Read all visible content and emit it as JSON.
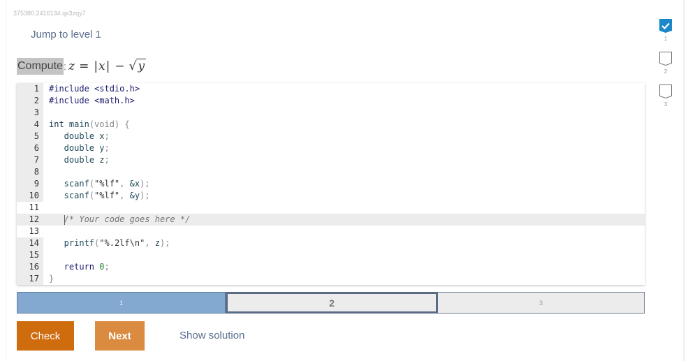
{
  "activity_id": "375380.2416134.qx3zqy7",
  "jump_link": "Jump to level 1",
  "prompt": {
    "label": "Compute",
    "colon": ":",
    "math": {
      "lhs": "z",
      "eq": "=",
      "abs_open": "|",
      "x": "x",
      "abs_close": "|",
      "minus": "−",
      "sqrt": "√",
      "y": "y"
    }
  },
  "editor": {
    "lines": [
      {
        "n": "1",
        "tokens": [
          {
            "t": "#include <stdio.h>",
            "c": "pre"
          }
        ]
      },
      {
        "n": "2",
        "tokens": [
          {
            "t": "#include <math.h>",
            "c": "pre"
          }
        ]
      },
      {
        "n": "3",
        "tokens": []
      },
      {
        "n": "4",
        "tokens": [
          {
            "t": "int",
            "c": "kw"
          },
          {
            "t": " main",
            "c": "fn"
          },
          {
            "t": "(void) {",
            "c": "punc"
          }
        ]
      },
      {
        "n": "5",
        "tokens": [
          {
            "t": "   double",
            "c": "type"
          },
          {
            "t": " x",
            "c": "fn"
          },
          {
            "t": ";",
            "c": "punc"
          }
        ]
      },
      {
        "n": "6",
        "tokens": [
          {
            "t": "   double",
            "c": "type"
          },
          {
            "t": " y",
            "c": "fn"
          },
          {
            "t": ";",
            "c": "punc"
          }
        ]
      },
      {
        "n": "7",
        "tokens": [
          {
            "t": "   double",
            "c": "type"
          },
          {
            "t": " z",
            "c": "fn"
          },
          {
            "t": ";",
            "c": "punc"
          }
        ]
      },
      {
        "n": "8",
        "tokens": []
      },
      {
        "n": "9",
        "tokens": [
          {
            "t": "   scanf",
            "c": "fn"
          },
          {
            "t": "(",
            "c": "punc"
          },
          {
            "t": "\"%lf\"",
            "c": "str"
          },
          {
            "t": ", ",
            "c": "punc"
          },
          {
            "t": "&x",
            "c": "fn"
          },
          {
            "t": ");",
            "c": "punc"
          }
        ]
      },
      {
        "n": "10",
        "tokens": [
          {
            "t": "   scanf",
            "c": "fn"
          },
          {
            "t": "(",
            "c": "punc"
          },
          {
            "t": "\"%lf\"",
            "c": "str"
          },
          {
            "t": ", ",
            "c": "punc"
          },
          {
            "t": "&y",
            "c": "fn"
          },
          {
            "t": ");",
            "c": "punc"
          }
        ]
      },
      {
        "n": "11",
        "tokens": [],
        "editable": true
      },
      {
        "n": "12",
        "tokens": [
          {
            "t": "   ",
            "c": "fn"
          },
          {
            "t": "|cursor|",
            "c": "cursor"
          },
          {
            "t": "/* Your code goes here */",
            "c": "comment"
          }
        ],
        "editable": true,
        "active": true
      },
      {
        "n": "13",
        "tokens": [],
        "editable": true
      },
      {
        "n": "14",
        "tokens": [
          {
            "t": "   printf",
            "c": "fn"
          },
          {
            "t": "(",
            "c": "punc"
          },
          {
            "t": "\"%.2lf\\n\"",
            "c": "str"
          },
          {
            "t": ", ",
            "c": "punc"
          },
          {
            "t": "z",
            "c": "fn"
          },
          {
            "t": ");",
            "c": "punc"
          }
        ]
      },
      {
        "n": "15",
        "tokens": []
      },
      {
        "n": "16",
        "tokens": [
          {
            "t": "   return",
            "c": "ret"
          },
          {
            "t": " ",
            "c": "fn"
          },
          {
            "t": "0",
            "c": "num"
          },
          {
            "t": ";",
            "c": "punc"
          }
        ]
      },
      {
        "n": "17",
        "tokens": [
          {
            "t": "}",
            "c": "punc"
          }
        ]
      }
    ]
  },
  "level_bar": {
    "levels": [
      {
        "label": "1",
        "state": "done"
      },
      {
        "label": "2",
        "state": "current"
      },
      {
        "label": "3",
        "state": "todo"
      }
    ]
  },
  "buttons": {
    "check": "Check",
    "next": "Next",
    "show_solution": "Show solution"
  },
  "side_levels": [
    {
      "label": "1",
      "state": "completed",
      "icon": "check-icon"
    },
    {
      "label": "2",
      "state": "incomplete",
      "icon": "empty-badge-icon"
    },
    {
      "label": "3",
      "state": "incomplete",
      "icon": "empty-badge-icon"
    }
  ],
  "colors": {
    "accent_blue": "#1c87c9",
    "check_button": "#cf6c0e",
    "next_button": "#da8b3f",
    "level_done": "#84a9d0",
    "level_current_border": "#5a6b86",
    "link": "#5a6e8c"
  }
}
